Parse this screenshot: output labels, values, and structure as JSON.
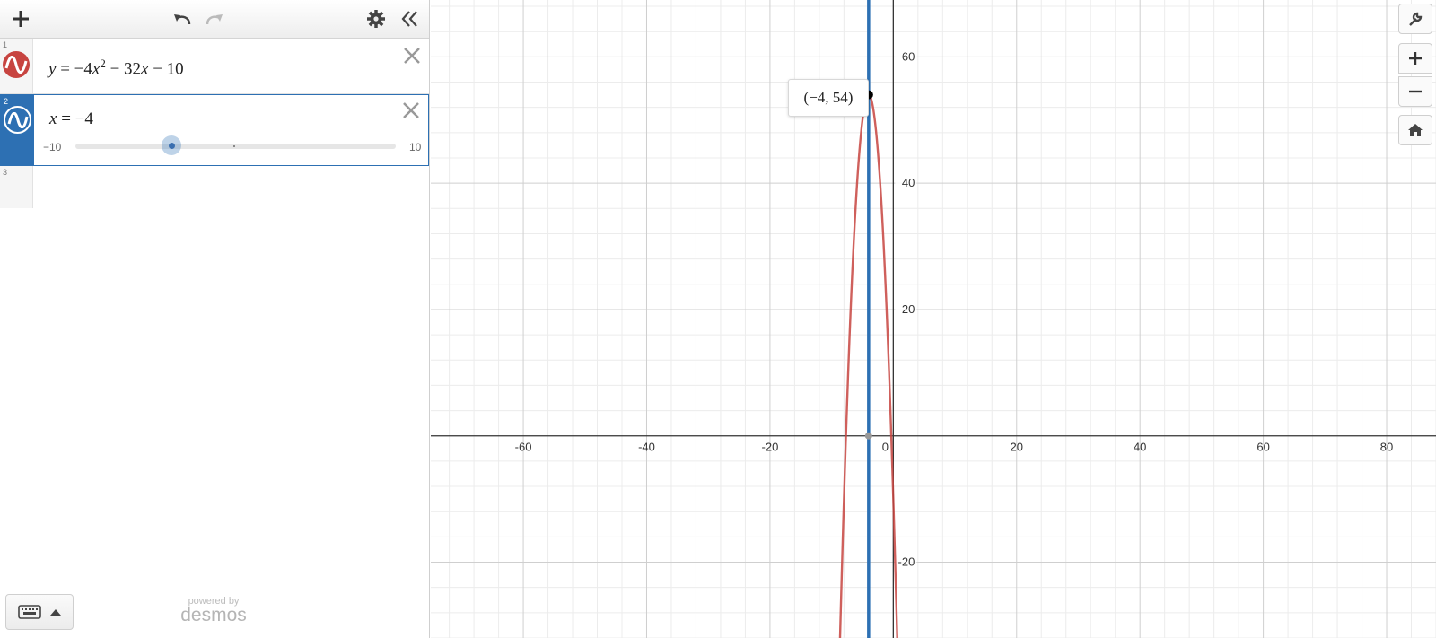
{
  "toolbar": {
    "add_icon": "plus-icon",
    "undo_icon": "undo-icon",
    "redo_icon": "redo-icon",
    "settings_icon": "gear-icon",
    "collapse_icon": "double-chevron-left-icon"
  },
  "expressions": [
    {
      "index": "1",
      "color": "#c74440",
      "latex_parts": {
        "y": "y",
        "eq": " = −4",
        "x1": "x",
        "sup": "2",
        "mid": " − 32",
        "x2": "x",
        "end": " − 10"
      }
    },
    {
      "index": "2",
      "color": "#2d70b3",
      "latex_parts": {
        "x": "x",
        "rest": " = −4"
      },
      "slider": {
        "min_label": "−10",
        "max_label": "10",
        "min": -10,
        "max": 10,
        "value": -4
      }
    },
    {
      "index": "3"
    }
  ],
  "branding": {
    "powered_by": "powered by",
    "name": "desmos"
  },
  "graph": {
    "x_range": [
      -75,
      88
    ],
    "y_range": [
      -32,
      69
    ],
    "x_ticks": [
      "-60",
      "-40",
      "-20",
      "0",
      "20",
      "40",
      "60",
      "80"
    ],
    "y_ticks": [
      "60",
      "40",
      "20",
      "-20"
    ],
    "point_label": "(−4, 54)"
  },
  "side_controls": {
    "wrench_icon": "wrench-icon",
    "zoom_in_icon": "plus-icon",
    "zoom_out_icon": "minus-icon",
    "home_icon": "home-icon"
  }
}
